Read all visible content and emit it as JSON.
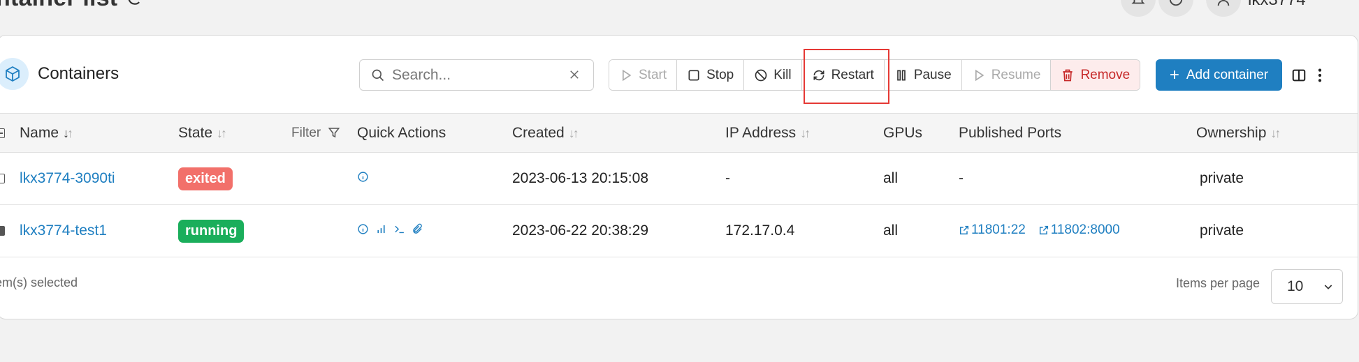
{
  "page": {
    "title": "ntainer list",
    "user_name": "lkx3774"
  },
  "card": {
    "title": "Containers"
  },
  "search": {
    "placeholder": "Search...",
    "value": ""
  },
  "toolbar": {
    "start": "Start",
    "stop": "Stop",
    "kill": "Kill",
    "restart": "Restart",
    "pause": "Pause",
    "resume": "Resume",
    "remove": "Remove",
    "add_container": "Add container"
  },
  "columns": {
    "name": "Name",
    "state": "State",
    "filter": "Filter",
    "quick_actions": "Quick Actions",
    "created": "Created",
    "ip": "IP Address",
    "gpus": "GPUs",
    "ports": "Published Ports",
    "ownership": "Ownership"
  },
  "rows": [
    {
      "name": "lkx3774-3090ti",
      "state": "exited",
      "created": "2023-06-13 20:15:08",
      "ip": "-",
      "gpus": "all",
      "ports": "-",
      "ownership": "private",
      "checked": false
    },
    {
      "name": "lkx3774-test1",
      "state": "running",
      "created": "2023-06-22 20:38:29",
      "ip": "172.17.0.4",
      "gpus": "all",
      "ports": [
        "11801:22",
        "11802:8000"
      ],
      "ownership": "private",
      "checked": true
    }
  ],
  "footer": {
    "selected_text": "em(s) selected",
    "items_per_page_label": "Items per page",
    "items_per_page": "10"
  },
  "colors": {
    "accent": "#1f7fc1",
    "exited": "#f2706a",
    "running": "#1aae5b",
    "danger_bg": "#fdecec",
    "danger_text": "#c62828",
    "highlight": "#e53935"
  }
}
